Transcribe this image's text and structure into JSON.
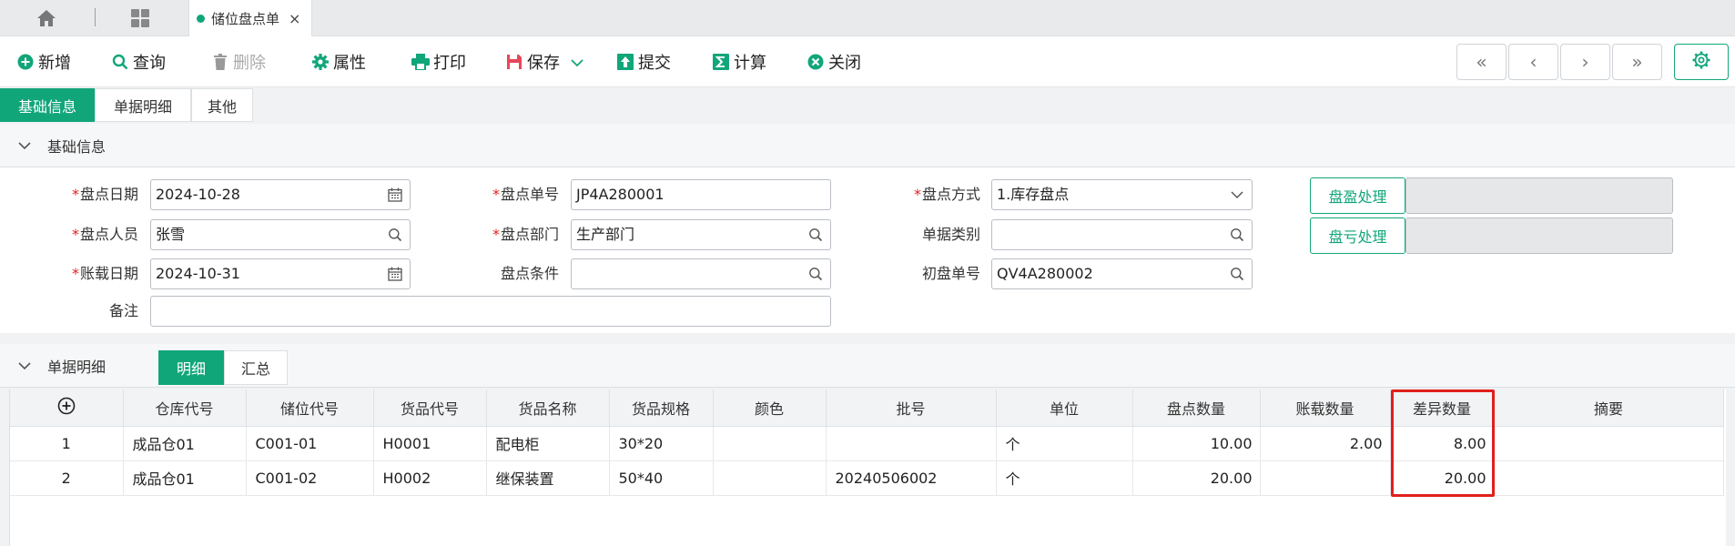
{
  "tabs": {
    "doc_tab": "储位盘点单",
    "close": "×"
  },
  "toolbar": {
    "add": "新增",
    "query": "查询",
    "delete": "删除",
    "properties": "属性",
    "print": "打印",
    "save": "保存",
    "submit": "提交",
    "calculate": "计算",
    "close": "关闭"
  },
  "nav": {
    "first": "«",
    "prev": "‹",
    "next": "›",
    "last": "»"
  },
  "subtabs": [
    "基础信息",
    "单据明细",
    "其他"
  ],
  "basic_section": {
    "title": "基础信息"
  },
  "form": {
    "check_date_label": "盘点日期",
    "check_date": "2024-10-28",
    "check_no_label": "盘点单号",
    "check_no": "JP4A280001",
    "check_method_label": "盘点方式",
    "check_method": "1.库存盘点",
    "checker_label": "盘点人员",
    "checker": "张雪",
    "check_dept_label": "盘点部门",
    "check_dept": "生产部门",
    "doc_type_label": "单据类别",
    "doc_type": "",
    "book_date_label": "账载日期",
    "book_date": "2024-10-31",
    "check_cond_label": "盘点条件",
    "check_cond": "",
    "first_check_no_label": "初盘单号",
    "first_check_no": "QV4A280002",
    "remark_label": "备注",
    "remark": "",
    "surplus_btn": "盘盈处理",
    "deficit_btn": "盘亏处理"
  },
  "detail_section": {
    "title": "单据明细",
    "tab_detail": "明细",
    "tab_summary": "汇总"
  },
  "grid": {
    "add_row_icon": "plus-circle-icon",
    "columns": [
      "仓库代号",
      "储位代号",
      "货品代号",
      "货品名称",
      "货品规格",
      "颜色",
      "批号",
      "单位",
      "盘点数量",
      "账载数量",
      "差异数量",
      "摘要"
    ],
    "rows": [
      {
        "no": "1",
        "warehouse": "成品仓01",
        "location": "C001-01",
        "item_code": "H0001",
        "item_name": "配电柜",
        "spec": "30*20",
        "color": "",
        "batch": "",
        "unit": "个",
        "check_qty": "10.00",
        "book_qty": "2.00",
        "diff_qty": "8.00",
        "summary": ""
      },
      {
        "no": "2",
        "warehouse": "成品仓01",
        "location": "C001-02",
        "item_code": "H0002",
        "item_name": "继保装置",
        "spec": "50*40",
        "color": "",
        "batch": "20240506002",
        "unit": "个",
        "check_qty": "20.00",
        "book_qty": "",
        "diff_qty": "20.00",
        "summary": ""
      }
    ]
  },
  "colors": {
    "accent": "#11a67a",
    "required": "#e02020",
    "highlight": "#e0201c"
  }
}
